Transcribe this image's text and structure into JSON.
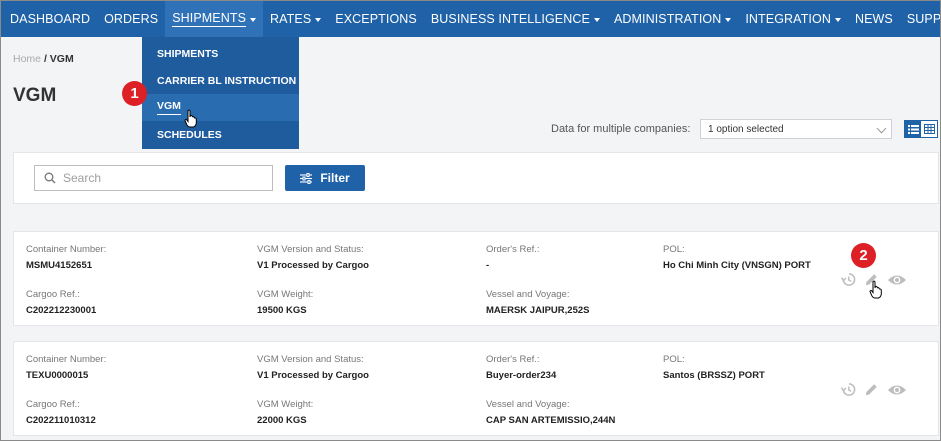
{
  "nav": {
    "items": [
      {
        "label": "DASHBOARD",
        "caret": false
      },
      {
        "label": "ORDERS",
        "caret": false
      },
      {
        "label": "SHIPMENTS",
        "caret": true,
        "active": true
      },
      {
        "label": "RATES",
        "caret": true
      },
      {
        "label": "EXCEPTIONS",
        "caret": false
      },
      {
        "label": "BUSINESS INTELLIGENCE",
        "caret": true
      },
      {
        "label": "ADMINISTRATION",
        "caret": true
      },
      {
        "label": "INTEGRATION",
        "caret": true
      },
      {
        "label": "NEWS",
        "caret": false
      },
      {
        "label": "SUPPORT CENTER",
        "caret": false
      }
    ],
    "dropdown": [
      "SHIPMENTS",
      "CARRIER BL INSTRUCTION",
      "VGM",
      "SCHEDULES"
    ]
  },
  "breadcrumb": {
    "home": "Home",
    "separator": "/",
    "current": "VGM"
  },
  "page": {
    "title": "VGM"
  },
  "company_filter": {
    "label": "Data for multiple companies:",
    "value": "1 option selected"
  },
  "search": {
    "placeholder": "Search",
    "filter_label": "Filter"
  },
  "labels": {
    "container": "Container Number:",
    "vgm_status": "VGM Version and Status:",
    "orders_ref": "Order's Ref.:",
    "pol": "POL:",
    "cargoo_ref": "Cargoo Ref.:",
    "vgm_weight": "VGM Weight:",
    "vessel": "Vessel and Voyage:"
  },
  "records": [
    {
      "container": "MSMU4152651",
      "vgm_status": "V1 Processed by Cargoo",
      "orders_ref": "-",
      "pol": "Ho Chi Minh City (VNSGN) PORT",
      "cargoo_ref": "C202212230001",
      "vgm_weight": "19500 KGS",
      "vessel": "MAERSK JAIPUR,252S"
    },
    {
      "container": "TEXU0000015",
      "vgm_status": "V1 Processed by Cargoo",
      "orders_ref": "Buyer-order234",
      "pol": "Santos (BRSSZ) PORT",
      "cargoo_ref": "C202211010312",
      "vgm_weight": "22000 KGS",
      "vessel": "CAP SAN ARTEMISSIO,244N"
    }
  ],
  "steps": {
    "one": "1",
    "two": "2"
  },
  "icons": {
    "history": "history-icon",
    "edit": "pencil-icon",
    "view": "eye-icon",
    "search": "search-icon",
    "filter": "sliders-icon",
    "list": "list-view-icon",
    "grid": "grid-view-icon",
    "cursor": "hand-pointer-icon"
  },
  "colors": {
    "nav": "#1f62a8",
    "accent": "#1f62a8",
    "step_marker": "#dd1f26"
  }
}
